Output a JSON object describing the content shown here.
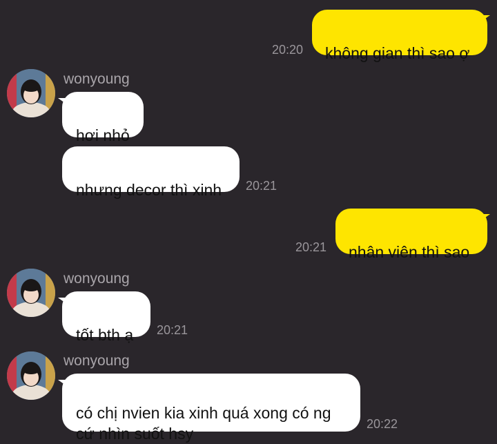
{
  "colors": {
    "background": "#2a262b",
    "outgoing_bubble": "#fee500",
    "incoming_bubble": "#ffffff",
    "timestamp": "#9a969b",
    "sender_name": "#a9a5aa"
  },
  "messages": [
    {
      "id": "m1",
      "direction": "outgoing",
      "text": "không gian thì sao ợ",
      "time": "20:20"
    },
    {
      "id": "m2",
      "direction": "incoming",
      "sender": "wonyoung",
      "text": "hơi nhỏ",
      "time": ""
    },
    {
      "id": "m3",
      "direction": "incoming",
      "text": "nhưng decor thì xinh",
      "time": "20:21"
    },
    {
      "id": "m4",
      "direction": "outgoing",
      "text": "nhân viên thì sao",
      "time": "20:21"
    },
    {
      "id": "m5",
      "direction": "incoming",
      "sender": "wonyoung",
      "text": "tốt bth ạ",
      "time": "20:21"
    },
    {
      "id": "m6",
      "direction": "incoming",
      "sender": "wonyoung",
      "text": "có chị nvien kia xinh quá xong có ng\ncứ nhìn suốt hsy",
      "time": "20:22"
    }
  ],
  "avatar_icon": "profile-photo-avatar"
}
